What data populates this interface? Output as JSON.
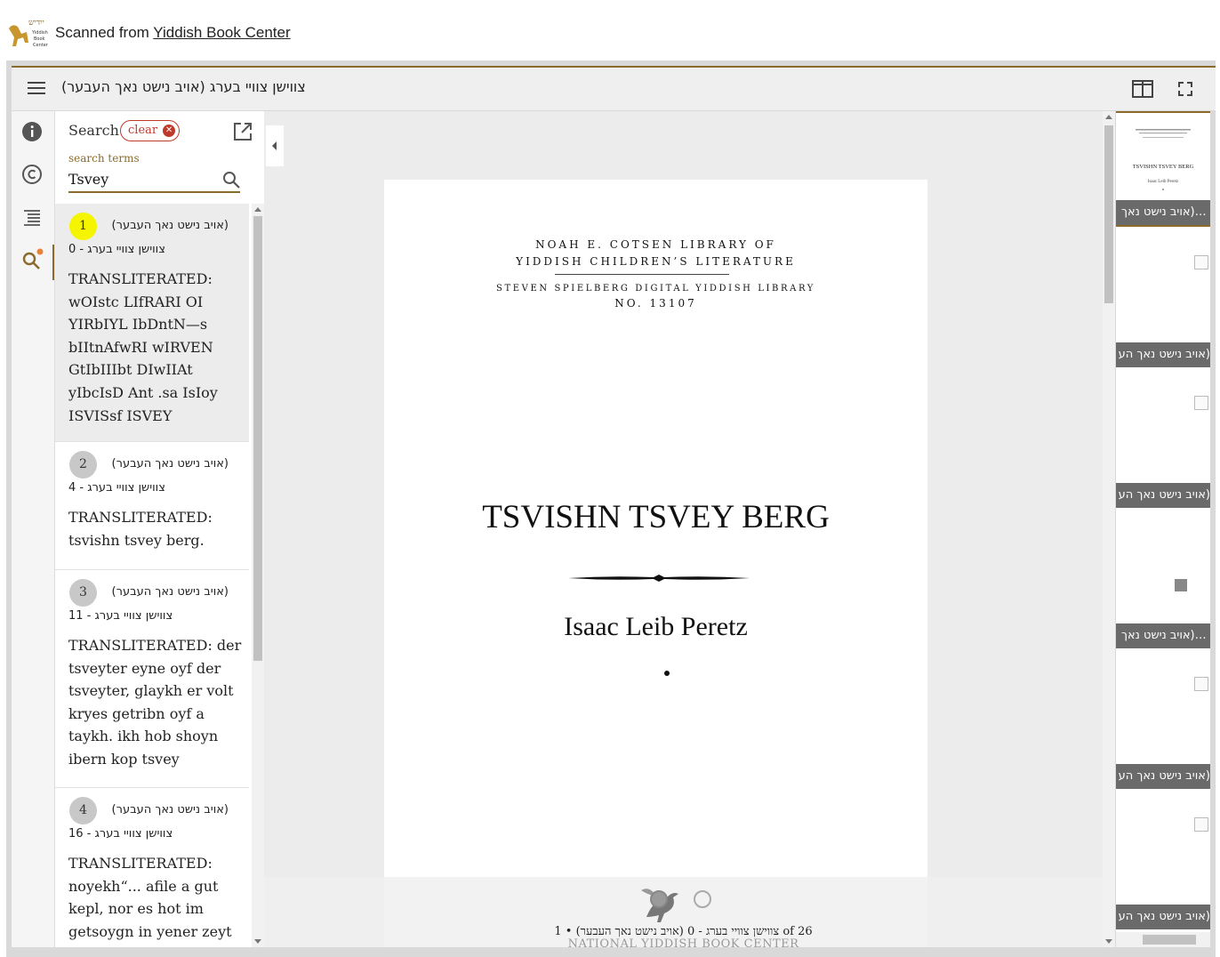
{
  "banner": {
    "prefix": "Scanned from",
    "link_text": "Yiddish Book Center"
  },
  "toolbar": {
    "title": "צווישן צוויי בערג (אויב נישט נאך העבער)"
  },
  "search": {
    "heading": "Search",
    "clear_label": "clear",
    "terms_label": "search terms",
    "query": "Tsvey"
  },
  "results": [
    {
      "number": "1",
      "title": "(אויב נישט נאך העבער)",
      "subtitle": "צווישן צוויי בערג - 0",
      "text": "TRANSLITERATED: wOIstc LIfRARI OI YIRbIYL IbDntN—s bIItnAfwRI wIRVEN GtIbIIIbt DIwIIAt yIbcIsD Ant .sa IsIoy ISVISsf ISVEY",
      "active": true
    },
    {
      "number": "2",
      "title": "(אויב נישט נאך העבער)",
      "subtitle": "צווישן צוויי בערג - 4",
      "text": "TRANSLITERATED: tsvishn tsvey berg.",
      "active": false
    },
    {
      "number": "3",
      "title": "(אויב נישט נאך העבער)",
      "subtitle": "צווישן צוויי בערג - 11",
      "text": "TRANSLITERATED: der tsveyter eyne oyf der tsveyter, glaykh er volt kryes getribn oyf a taykh. ikh hob shoyn ibern kop tsvey",
      "active": false
    },
    {
      "number": "4",
      "title": "(אויב נישט נאך העבער)",
      "subtitle": "צווישן צוויי בערג - 16",
      "text": "TRANSLITERATED: noyekh“... afile a gut kepl, nor es hot im getsoygn in yener zeyt",
      "active": false
    }
  ],
  "page": {
    "line1": "NOAH E. COTSEN LIBRARY OF",
    "line2": "YIDDISH CHILDREN’S LITERATURE",
    "line3": "STEVEN SPIELBERG DIGITAL YIDDISH LIBRARY",
    "line4": "NO. 13107",
    "title": "TSVISHN TSVEY BERG",
    "author": "Isaac Leib Peretz"
  },
  "navigation": {
    "caption": "צווישן צוויי בערג - 0 (אויב נישט נאך העבער) • 1 of 26",
    "footer_partial": "NATIONAL YIDDISH BOOK CENTER"
  },
  "thumbnails": {
    "thumb1_label": "…(אויב נישט נאך",
    "thumb2_label": "(אויב נישט נאך הע",
    "thumb3_label": "(אויב נישט נאך הע",
    "thumb4_label": "…(אויב נישט נאך",
    "thumb5_label": "(אויב נישט נאך הע",
    "thumb6_label": "(אויב נישט נאך הע"
  },
  "icons": {
    "logo": "yiddish-book-center-logo",
    "menu": "hamburger-icon",
    "info": "info-icon",
    "rights": "copyright-icon",
    "index": "index-list-icon",
    "search": "search-icon",
    "popout": "open-in-new-icon",
    "book_view": "book-view-icon",
    "fullscreen": "fullscreen-icon"
  },
  "colors": {
    "accent": "#8a6b2b",
    "clear": "#c0392b",
    "highlight": "#f5f500"
  }
}
